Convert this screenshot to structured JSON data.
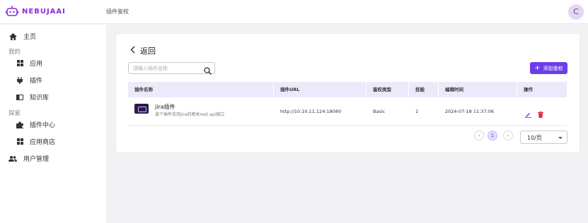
{
  "brand": {
    "name": "NEBUJAAI",
    "color": "#8b2be2"
  },
  "header": {
    "breadcrumb": "插件鉴权",
    "avatar_letter": "C"
  },
  "sidebar": {
    "home": {
      "label": "主页",
      "icon": "home-icon"
    },
    "section_mine": "我的",
    "mine_items": [
      {
        "label": "应用",
        "icon": "grid-icon"
      },
      {
        "label": "插件",
        "icon": "plug-icon"
      },
      {
        "label": "知识库",
        "icon": "book-icon"
      }
    ],
    "section_explore": "探索",
    "explore_items": [
      {
        "label": "插件中心",
        "icon": "puzzle-icon"
      },
      {
        "label": "应用商店",
        "icon": "grid-icon"
      }
    ],
    "user_mgmt": {
      "label": "用户管理",
      "icon": "people-icon"
    }
  },
  "main": {
    "back_label": "返回",
    "search_placeholder": "请输入插件名称",
    "add_button": "添加鉴权",
    "accent": "#6b3ee8",
    "columns": [
      "插件名称",
      "插件URL",
      "鉴权类型",
      "技能",
      "编辑时间",
      "操作"
    ],
    "rows": [
      {
        "name": "jira插件",
        "desc": "该个插件支持jira的相关rest api接口",
        "url": "http://10.10.11.124:18080",
        "auth_type": "Basic",
        "skills": "1",
        "edited": "2024-07-18 11:37:06"
      }
    ],
    "pagination": {
      "current_page": "1",
      "page_size": "10/页",
      "prev": "‹",
      "next": "›"
    }
  }
}
